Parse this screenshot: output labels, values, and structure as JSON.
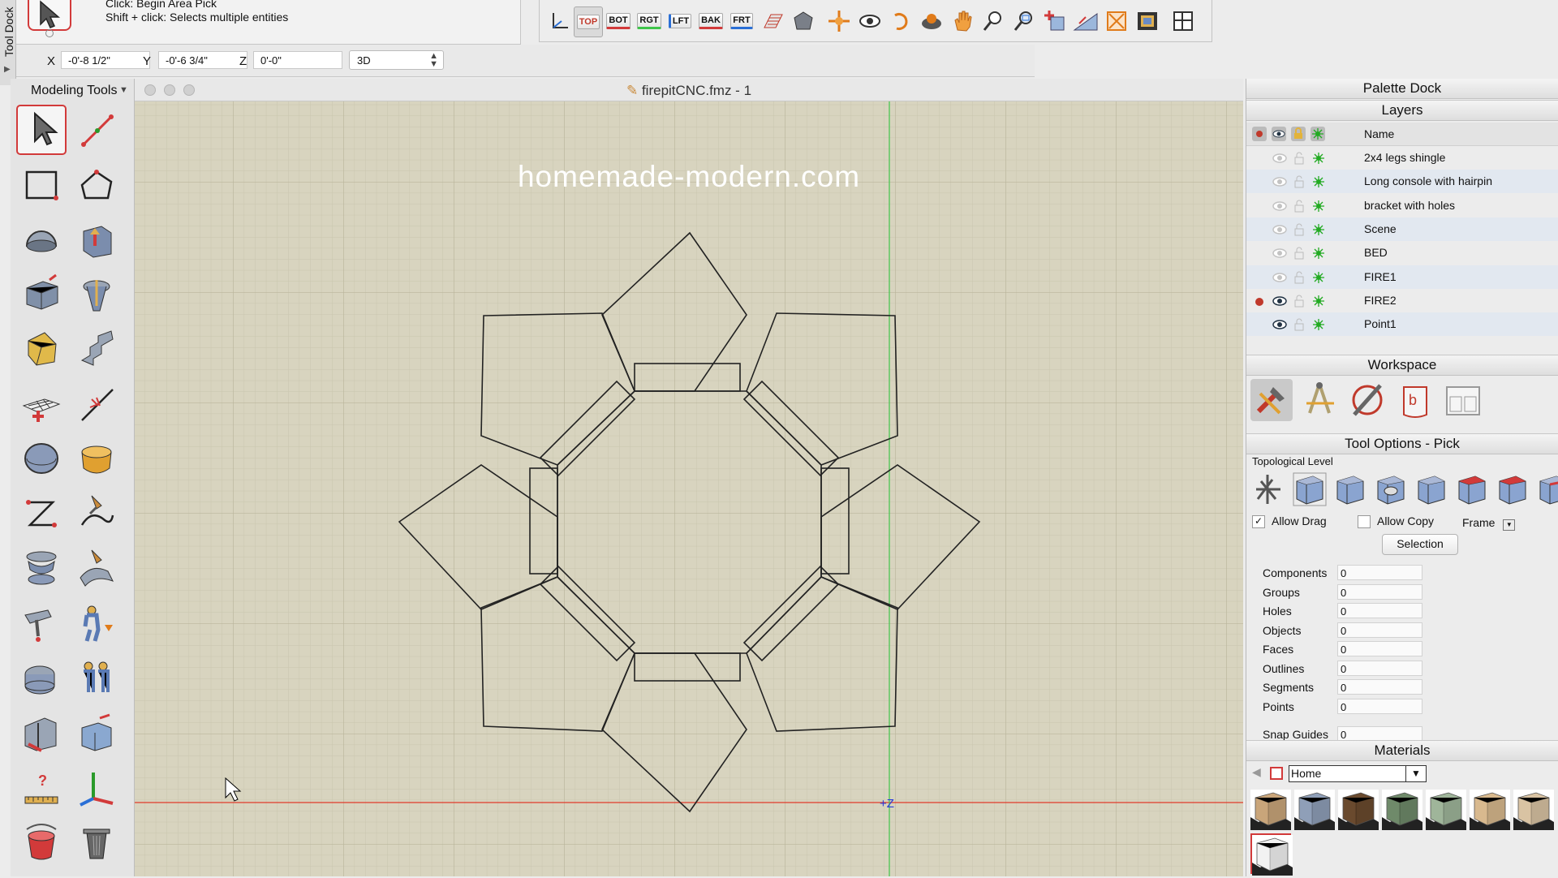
{
  "tool_dock": {
    "label": "Tool Dock"
  },
  "hint": {
    "line1": "Click: Begin Area Pick",
    "line2": "Shift + click: Selects multiple entities"
  },
  "view_toolbar": {
    "labels": [
      "TOP",
      "BOT",
      "RGT",
      "LFT",
      "BAK",
      "FRT"
    ],
    "icons": [
      "axis-view-icon",
      "top-view-icon",
      "bottom-view-icon",
      "right-view-icon",
      "left-view-icon",
      "back-view-icon",
      "front-view-icon",
      "grid-plane-icon",
      "shape-icon",
      "move-view-icon",
      "orbit-eye-icon",
      "undo-view-icon",
      "walk-icon",
      "pan-hand-icon",
      "zoom-icon",
      "zoom-window-icon",
      "add-view-icon",
      "perspective-icon",
      "fit-all-icon",
      "render-icon",
      "layout-icon"
    ]
  },
  "coords": {
    "x_label": "X",
    "x": "-0'-8 1/2\"",
    "y_label": "Y",
    "y": "-0'-6 3/4\"",
    "z_label": "Z",
    "z": "0'-0\"",
    "mode": "3D"
  },
  "modeling_tools": {
    "title": "Modeling Tools",
    "tools": [
      "pick-arrow-icon",
      "line-icon",
      "rectangle-icon",
      "polygon-icon",
      "sphere-icon",
      "extrude-icon",
      "box-push-icon",
      "revolve-icon",
      "solid-yellow-icon",
      "stairs-icon",
      "grid-plane-add-icon",
      "trim-icon",
      "round-solid-icon",
      "golden-blend-icon",
      "curve-icon",
      "hammer-curve-icon",
      "stack-icon",
      "sweep-icon",
      "drill-icon",
      "figure-icon",
      "cylinder-cut-icon",
      "group-figure-icon",
      "section-icon",
      "push-box-icon",
      "measure-icon",
      "axis-gizmo-icon",
      "paint-bucket-icon",
      "trash-icon"
    ]
  },
  "viewport": {
    "title": "firepitCNC.fmz - 1",
    "watermark": "homemade-modern.com",
    "axis_label": "+Z"
  },
  "palette": {
    "title": "Palette Dock",
    "layers": {
      "title": "Layers",
      "name_header": "Name",
      "rows": [
        {
          "name": "2x4 legs shingle",
          "active": false,
          "visible": false
        },
        {
          "name": "Long console with hairpin",
          "active": false,
          "visible": false
        },
        {
          "name": "bracket with holes",
          "active": false,
          "visible": false
        },
        {
          "name": "Scene",
          "active": false,
          "visible": false
        },
        {
          "name": "BED",
          "active": false,
          "visible": false
        },
        {
          "name": "FIRE1",
          "active": false,
          "visible": false
        },
        {
          "name": "FIRE2",
          "active": true,
          "visible": true
        },
        {
          "name": "Point1",
          "active": false,
          "visible": true
        }
      ]
    },
    "workspace": {
      "title": "Workspace",
      "icons": [
        "modeling-workspace-icon",
        "drafting-workspace-icon",
        "cam-workspace-icon",
        "3d-print-workspace-icon",
        "layout-workspace-icon"
      ]
    },
    "tool_options": {
      "title": "Tool Options - Pick",
      "topo_label": "Topological Level",
      "topo_icons": [
        "auto-topo-icon",
        "component-topo-icon",
        "group-topo-icon",
        "hole-topo-icon",
        "object-topo-icon",
        "face-topo-icon",
        "outline-topo-icon",
        "segment-topo-icon"
      ],
      "allow_drag_label": "Allow Drag",
      "allow_drag": true,
      "allow_copy_label": "Allow Copy",
      "allow_copy": false,
      "frame_label": "Frame",
      "selection_label": "Selection",
      "stats": [
        {
          "label": "Components",
          "value": "0"
        },
        {
          "label": "Groups",
          "value": "0"
        },
        {
          "label": "Holes",
          "value": "0"
        },
        {
          "label": "Objects",
          "value": "0"
        },
        {
          "label": "Faces",
          "value": "0"
        },
        {
          "label": "Outlines",
          "value": "0"
        },
        {
          "label": "Segments",
          "value": "0"
        },
        {
          "label": "Points",
          "value": "0"
        }
      ],
      "snap_label": "Snap Guides",
      "snap_value": "0"
    },
    "materials": {
      "title": "Materials",
      "library": "Home",
      "swatches": [
        "#c9a57a",
        "#8f9fb8",
        "#6a4a2e",
        "#6f8a6a",
        "#9fb59a",
        "#d8b98e",
        "#d9c3a3",
        "#f2f2f2"
      ]
    }
  },
  "colors": {
    "accent": "#d23a3a",
    "viewport_bg": "#d8d4bf",
    "grid": "#c6c2ab",
    "axis_x": "#e03a2a",
    "axis_y": "#3fc54a",
    "axis_label": "#2a3adc"
  }
}
